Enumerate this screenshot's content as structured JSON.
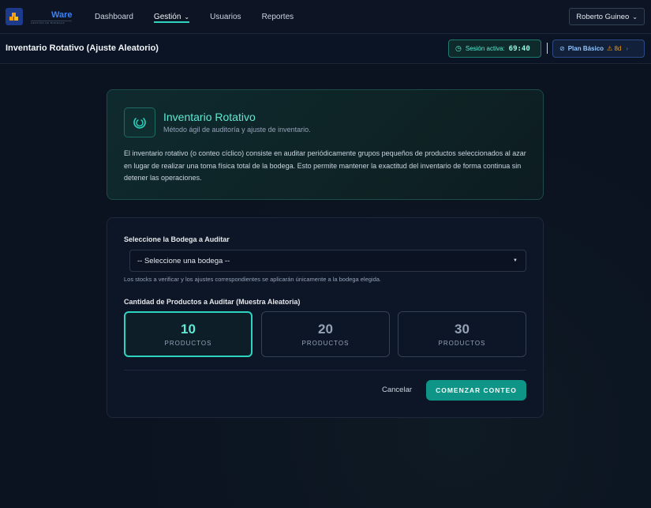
{
  "brand": {
    "name": "Ware",
    "tagline": "GESTIÓN DE BODEGAS"
  },
  "nav": {
    "items": [
      {
        "label": "Dashboard"
      },
      {
        "label": "Gestión"
      },
      {
        "label": "Usuarios"
      },
      {
        "label": "Reportes"
      }
    ],
    "active": "Gestión"
  },
  "user": {
    "name": "Roberto Guineo"
  },
  "page": {
    "title": "Inventario Rotativo (Ajuste Aleatorio)"
  },
  "session": {
    "label": "Sesión activa:",
    "timer": "69:40"
  },
  "plan": {
    "label": "Plan Básico",
    "days": "⚠ 8d"
  },
  "info": {
    "title": "Inventario Rotativo",
    "subtitle": "Método ágil de auditoría y ajuste de inventario.",
    "description": "El inventario rotativo (o conteo cíclico) consiste en auditar periódicamente grupos pequeños de productos seleccionados al azar en lugar de realizar una toma física total de la bodega. Esto permite mantener la exactitud del inventario de forma continua sin detener las operaciones."
  },
  "form": {
    "warehouse_label": "Seleccione la Bodega a Auditar",
    "warehouse_selected": "-- Seleccione una bodega --",
    "warehouse_hint": "Los stocks a verificar y los ajustes correspondientes se aplicarán únicamente a la bodega elegida.",
    "quantity_label": "Cantidad de Productos a Auditar (Muestra Aleatoria)",
    "options": [
      {
        "value": "10",
        "unit": "PRODUCTOS"
      },
      {
        "value": "20",
        "unit": "PRODUCTOS"
      },
      {
        "value": "30",
        "unit": "PRODUCTOS"
      }
    ],
    "selected_option": "10",
    "cancel_label": "Cancelar",
    "start_label": "COMENZAR CONTEO"
  },
  "colors": {
    "accent": "#2dd4bf",
    "primary_button": "#0f9488",
    "background": "#0b1220"
  }
}
